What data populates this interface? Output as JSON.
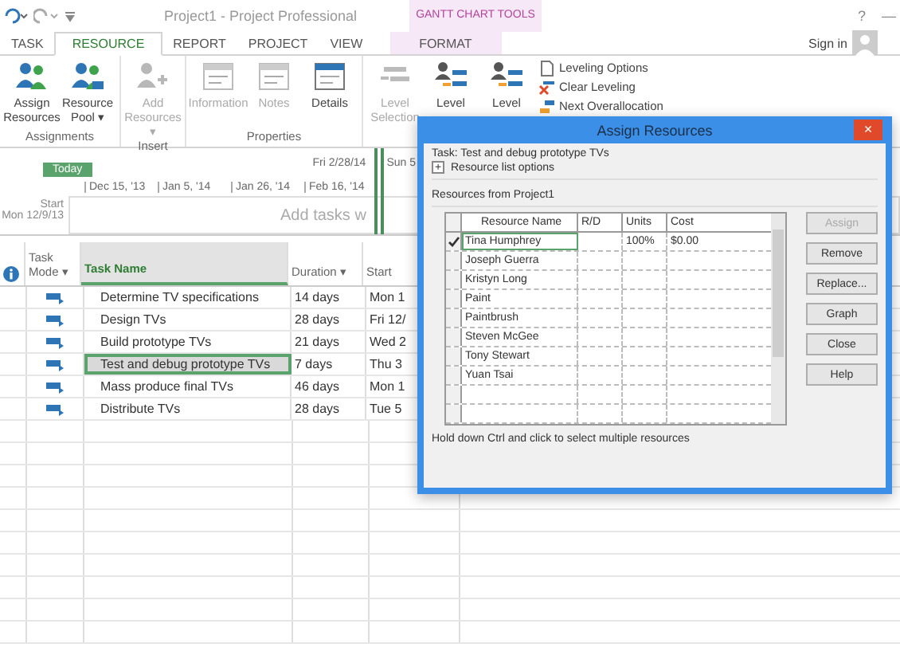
{
  "window": {
    "title": "Project1 - Project Professional",
    "context_tab_header": "GANTT CHART TOOLS",
    "help": "?",
    "minimize": "—",
    "sign_in": "Sign in"
  },
  "tabs": [
    {
      "label": "TASK",
      "selected": false
    },
    {
      "label": "RESOURCE",
      "selected": true
    },
    {
      "label": "REPORT",
      "selected": false
    },
    {
      "label": "PROJECT",
      "selected": false
    },
    {
      "label": "VIEW",
      "selected": false
    },
    {
      "label": "FORMAT",
      "selected": false
    }
  ],
  "ribbon_groups": [
    {
      "label": "Assignments",
      "buttons": [
        {
          "label": "Assign Resources",
          "disabled": false
        },
        {
          "label": "Resource Pool ▾",
          "disabled": false
        }
      ]
    },
    {
      "label": "Insert",
      "buttons": [
        {
          "label": "Add Resources ▾",
          "disabled": true
        }
      ]
    },
    {
      "label": "Properties",
      "buttons": [
        {
          "label": "Information",
          "disabled": true
        },
        {
          "label": "Notes",
          "disabled": true
        },
        {
          "label": "Details",
          "disabled": false
        }
      ]
    },
    {
      "buttons": [
        {
          "label": "Level Selection",
          "disabled": true
        },
        {
          "label": "Level",
          "disabled": false
        },
        {
          "label": "Level",
          "disabled": false
        }
      ],
      "small_buttons": [
        "Leveling Options",
        "Clear Leveling",
        "Next Overallocation"
      ]
    }
  ],
  "timeline": {
    "today": "Today",
    "date_top": "Fri 2/28/14",
    "date_top_2": "Sun 5",
    "dates": [
      "Dec 15, '13",
      "Jan 5, '14",
      "Jan 26, '14",
      "Feb 16, '14"
    ],
    "start_label": "Start",
    "start_date": "Mon 12/9/13",
    "placeholder": "Add tasks w"
  },
  "table": {
    "columns": [
      "Task Mode ▾",
      "Task Name",
      "Duration ▾",
      "Start"
    ],
    "rows": [
      {
        "name": "Determine TV specifications",
        "duration": "14 days",
        "start": "Mon 1",
        "selected": false
      },
      {
        "name": "Design TVs",
        "duration": "28 days",
        "start": "Fri 12/",
        "selected": false
      },
      {
        "name": "Build prototype TVs",
        "duration": "21 days",
        "start": "Wed 2",
        "selected": false
      },
      {
        "name": "Test and debug prototype TVs",
        "duration": "7 days",
        "start": "Thu 3",
        "selected": true
      },
      {
        "name": "Mass produce final TVs",
        "duration": "46 days",
        "start": "Mon 1",
        "selected": false
      },
      {
        "name": "Distribute TVs",
        "duration": "28 days",
        "start": "Tue 5",
        "selected": false
      }
    ]
  },
  "dialog": {
    "title": "Assign Resources",
    "close": "×",
    "task": "Task: Test and debug prototype TVs",
    "expander": "+",
    "options": "Resource list options",
    "section": "Resources from Project1",
    "columns": [
      "Resource Name",
      "R/D",
      "Units",
      "Cost"
    ],
    "resources": [
      {
        "name": "Tina Humphrey",
        "assigned": true,
        "units": "100%",
        "cost": "$0.00",
        "selected": true
      },
      {
        "name": "Joseph Guerra",
        "assigned": false,
        "selected": false
      },
      {
        "name": "Kristyn Long",
        "assigned": false,
        "selected": false
      },
      {
        "name": "Paint",
        "assigned": false,
        "selected": false
      },
      {
        "name": "Paintbrush",
        "assigned": false,
        "selected": false
      },
      {
        "name": "Steven McGee",
        "assigned": false,
        "selected": false
      },
      {
        "name": "Tony Stewart",
        "assigned": false,
        "selected": false
      },
      {
        "name": "Yuan Tsai",
        "assigned": false,
        "selected": false
      }
    ],
    "buttons": [
      {
        "label": "Assign",
        "disabled": true
      },
      {
        "label": "Remove",
        "disabled": false
      },
      {
        "label": "Replace...",
        "disabled": false
      },
      {
        "label": "Graph",
        "disabled": false
      },
      {
        "label": "Close",
        "disabled": false
      },
      {
        "label": "Help",
        "disabled": false
      }
    ],
    "hint": "Hold down Ctrl and click to select multiple resources"
  }
}
